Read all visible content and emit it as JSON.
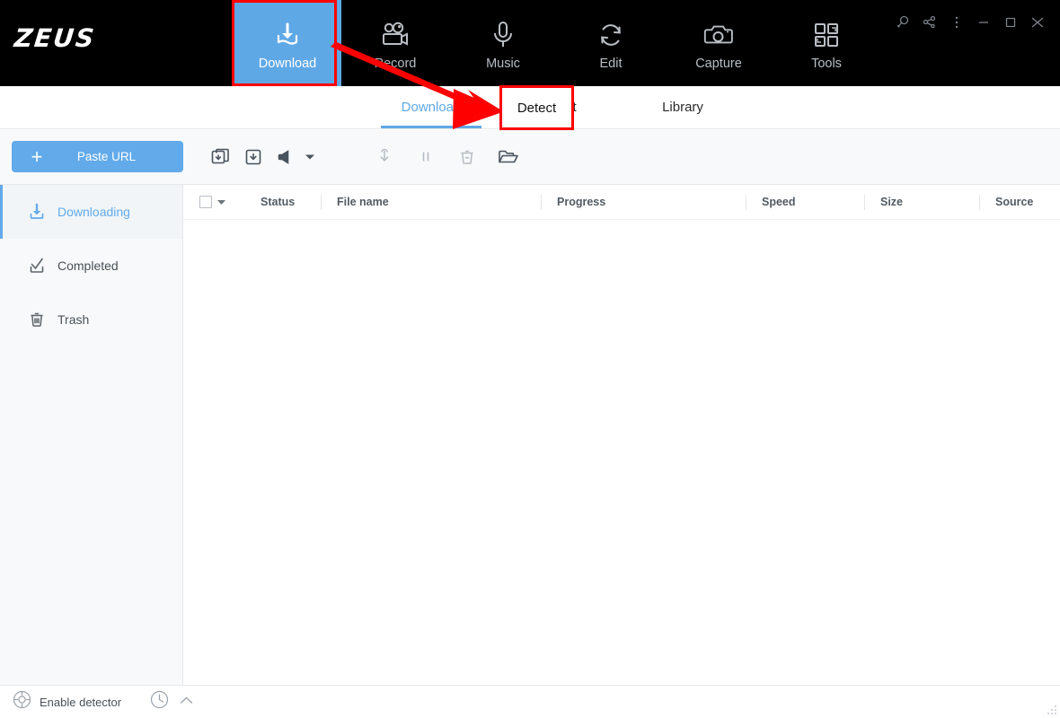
{
  "app": {
    "logo": "ZEUS"
  },
  "topnav": {
    "items": [
      {
        "label": "Download",
        "icon": "download-tray-icon",
        "active": true
      },
      {
        "label": "Record",
        "icon": "video-camera-icon",
        "active": false
      },
      {
        "label": "Music",
        "icon": "microphone-icon",
        "active": false
      },
      {
        "label": "Edit",
        "icon": "refresh-arrows-icon",
        "active": false
      },
      {
        "label": "Capture",
        "icon": "camera-icon",
        "active": false
      },
      {
        "label": "Tools",
        "icon": "grid-squares-icon",
        "active": false
      }
    ]
  },
  "window_controls": [
    {
      "name": "search-icon"
    },
    {
      "name": "share-icon"
    },
    {
      "name": "more-menu-icon"
    },
    {
      "name": "minimize-icon"
    },
    {
      "name": "maximize-icon"
    },
    {
      "name": "close-icon"
    }
  ],
  "subtabs": [
    {
      "label": "Download",
      "active": true
    },
    {
      "label": "Detect",
      "active": false
    },
    {
      "label": "Library",
      "active": false
    }
  ],
  "toolbar": {
    "paste_url_label": "Paste URL",
    "plus": "+",
    "buttons": [
      {
        "name": "batch-download-icon"
      },
      {
        "name": "download-icon"
      },
      {
        "name": "speaker-icon"
      },
      {
        "name": "start-download-icon"
      },
      {
        "name": "pause-icon"
      },
      {
        "name": "delete-icon"
      },
      {
        "name": "open-folder-icon"
      }
    ]
  },
  "sidebar": {
    "items": [
      {
        "label": "Downloading",
        "icon": "download-arrow-icon",
        "active": true
      },
      {
        "label": "Completed",
        "icon": "check-tray-icon",
        "active": false
      },
      {
        "label": "Trash",
        "icon": "trash-icon",
        "active": false
      }
    ]
  },
  "table": {
    "columns": [
      "Status",
      "File name",
      "Progress",
      "Speed",
      "Size",
      "Source"
    ],
    "rows": []
  },
  "bottombar": {
    "enable_detector_label": "Enable detector",
    "detector_icon": "target-icon",
    "clock_icon": "clock-icon",
    "chevron_icon": "chevron-up-icon"
  },
  "annotations": {
    "highlight_download": "Download",
    "highlight_detect": "Detect",
    "color": "#fe0000"
  },
  "colors": {
    "accent_blue": "#62aaea",
    "nav_black": "#000000",
    "panel_gray": "#f7f9fa",
    "annotation_red": "#fe0000"
  }
}
